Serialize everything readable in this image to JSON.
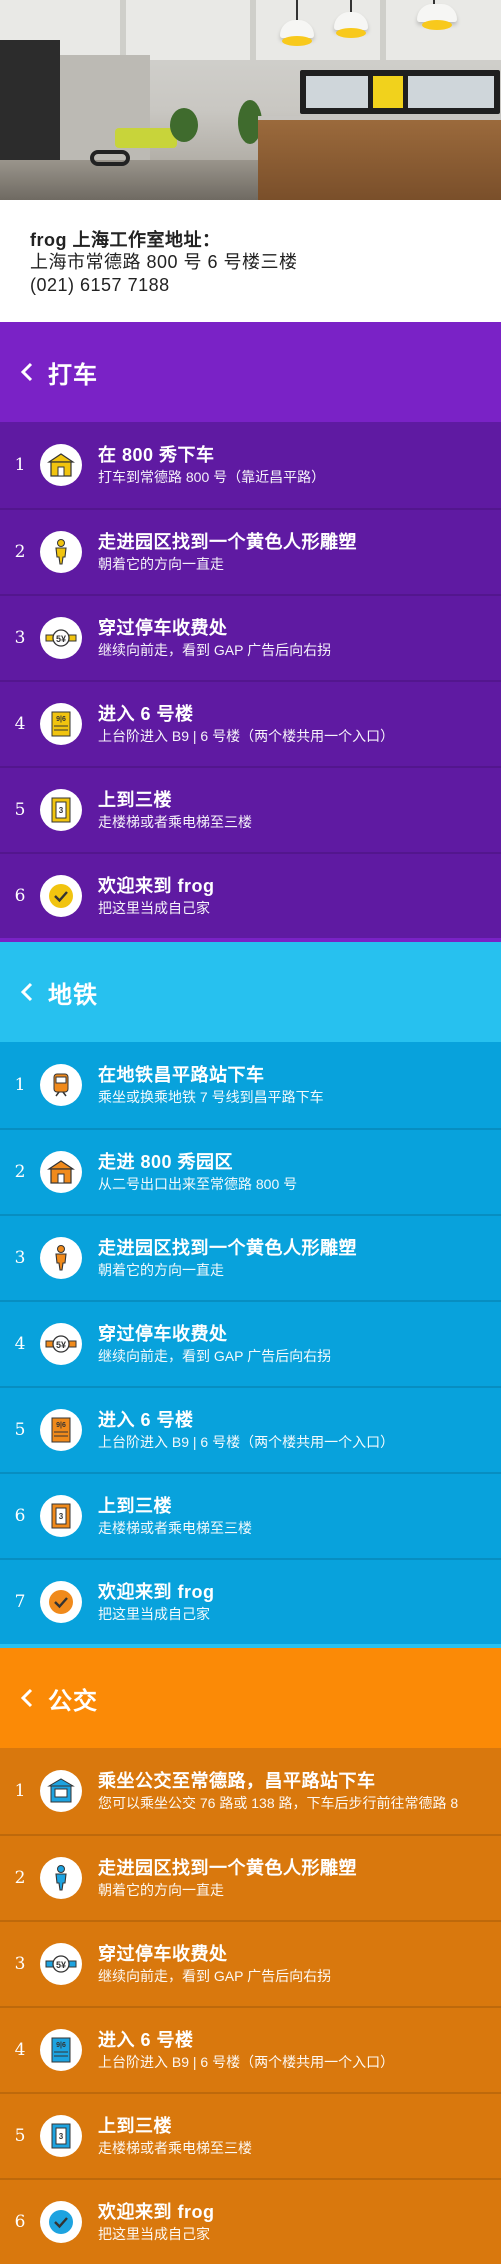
{
  "address": {
    "title": "frog 上海工作室地址：",
    "street": "上海市常德路 800 号 6 号楼三楼",
    "phone": "(021) 6157 7188"
  },
  "colors": {
    "taxi_header": "#7a22c6",
    "taxi_rows": "#5f1aa2",
    "metro_header": "#27c1ef",
    "metro_rows": "#08a2dc",
    "bus_header": "#fb8a06",
    "bus_rows": "#d9780d",
    "taxi_icon_accent": "#f1c40f",
    "metro_icon_accent": "#f08a1b",
    "bus_icon_accent": "#1da3e0"
  },
  "sections": [
    {
      "key": "taxi",
      "title": "打车",
      "steps": [
        {
          "num": "1",
          "icon": "building-gate-icon",
          "title": "在 800 秀下车",
          "desc": "打车到常德路 800 号（靠近昌平路）"
        },
        {
          "num": "2",
          "icon": "yellow-figure-statue-icon",
          "title": "走进园区找到一个黄色人形雕塑",
          "desc": "朝着它的方向一直走"
        },
        {
          "num": "3",
          "icon": "parking-toll-icon",
          "title": "穿过停车收费处",
          "desc": "继续向前走，看到 GAP 广告后向右拐"
        },
        {
          "num": "4",
          "icon": "building-six-icon",
          "title": "进入 6 号楼",
          "desc": "上台阶进入 B9 | 6 号楼（两个楼共用一个入口）"
        },
        {
          "num": "5",
          "icon": "third-floor-elevator-icon",
          "title": "上到三楼",
          "desc": "走楼梯或者乘电梯至三楼"
        },
        {
          "num": "6",
          "icon": "checkmark-icon",
          "title": "欢迎来到 frog",
          "desc": "把这里当成自己家"
        }
      ]
    },
    {
      "key": "metro",
      "title": "地铁",
      "steps": [
        {
          "num": "1",
          "icon": "metro-train-icon",
          "title": "在地铁昌平路站下车",
          "desc": "乘坐或换乘地铁 7 号线到昌平路下车"
        },
        {
          "num": "2",
          "icon": "building-gate-icon",
          "title": "走进 800 秀园区",
          "desc": "从二号出口出来至常德路 800 号"
        },
        {
          "num": "3",
          "icon": "yellow-figure-statue-icon",
          "title": "走进园区找到一个黄色人形雕塑",
          "desc": "朝着它的方向一直走"
        },
        {
          "num": "4",
          "icon": "parking-toll-icon",
          "title": "穿过停车收费处",
          "desc": "继续向前走，看到 GAP 广告后向右拐"
        },
        {
          "num": "5",
          "icon": "building-six-icon",
          "title": "进入 6 号楼",
          "desc": "上台阶进入 B9 | 6 号楼（两个楼共用一个入口）"
        },
        {
          "num": "6",
          "icon": "third-floor-elevator-icon",
          "title": "上到三楼",
          "desc": "走楼梯或者乘电梯至三楼"
        },
        {
          "num": "7",
          "icon": "checkmark-icon",
          "title": "欢迎来到 frog",
          "desc": "把这里当成自己家"
        }
      ]
    },
    {
      "key": "bus",
      "title": "公交",
      "steps": [
        {
          "num": "1",
          "icon": "bus-stop-icon",
          "title": "乘坐公交至常德路，昌平路站下车",
          "desc": "您可以乘坐公交 76 路或 138 路，下车后步行前往常德路 8"
        },
        {
          "num": "2",
          "icon": "yellow-figure-statue-icon",
          "title": "走进园区找到一个黄色人形雕塑",
          "desc": "朝着它的方向一直走"
        },
        {
          "num": "3",
          "icon": "parking-toll-icon",
          "title": "穿过停车收费处",
          "desc": "继续向前走，看到 GAP 广告后向右拐"
        },
        {
          "num": "4",
          "icon": "building-six-icon",
          "title": "进入 6 号楼",
          "desc": "上台阶进入 B9 | 6 号楼（两个楼共用一个入口）"
        },
        {
          "num": "5",
          "icon": "third-floor-elevator-icon",
          "title": "上到三楼",
          "desc": "走楼梯或者乘电梯至三楼"
        },
        {
          "num": "6",
          "icon": "checkmark-icon",
          "title": "欢迎来到 frog",
          "desc": "把这里当成自己家"
        }
      ]
    }
  ]
}
